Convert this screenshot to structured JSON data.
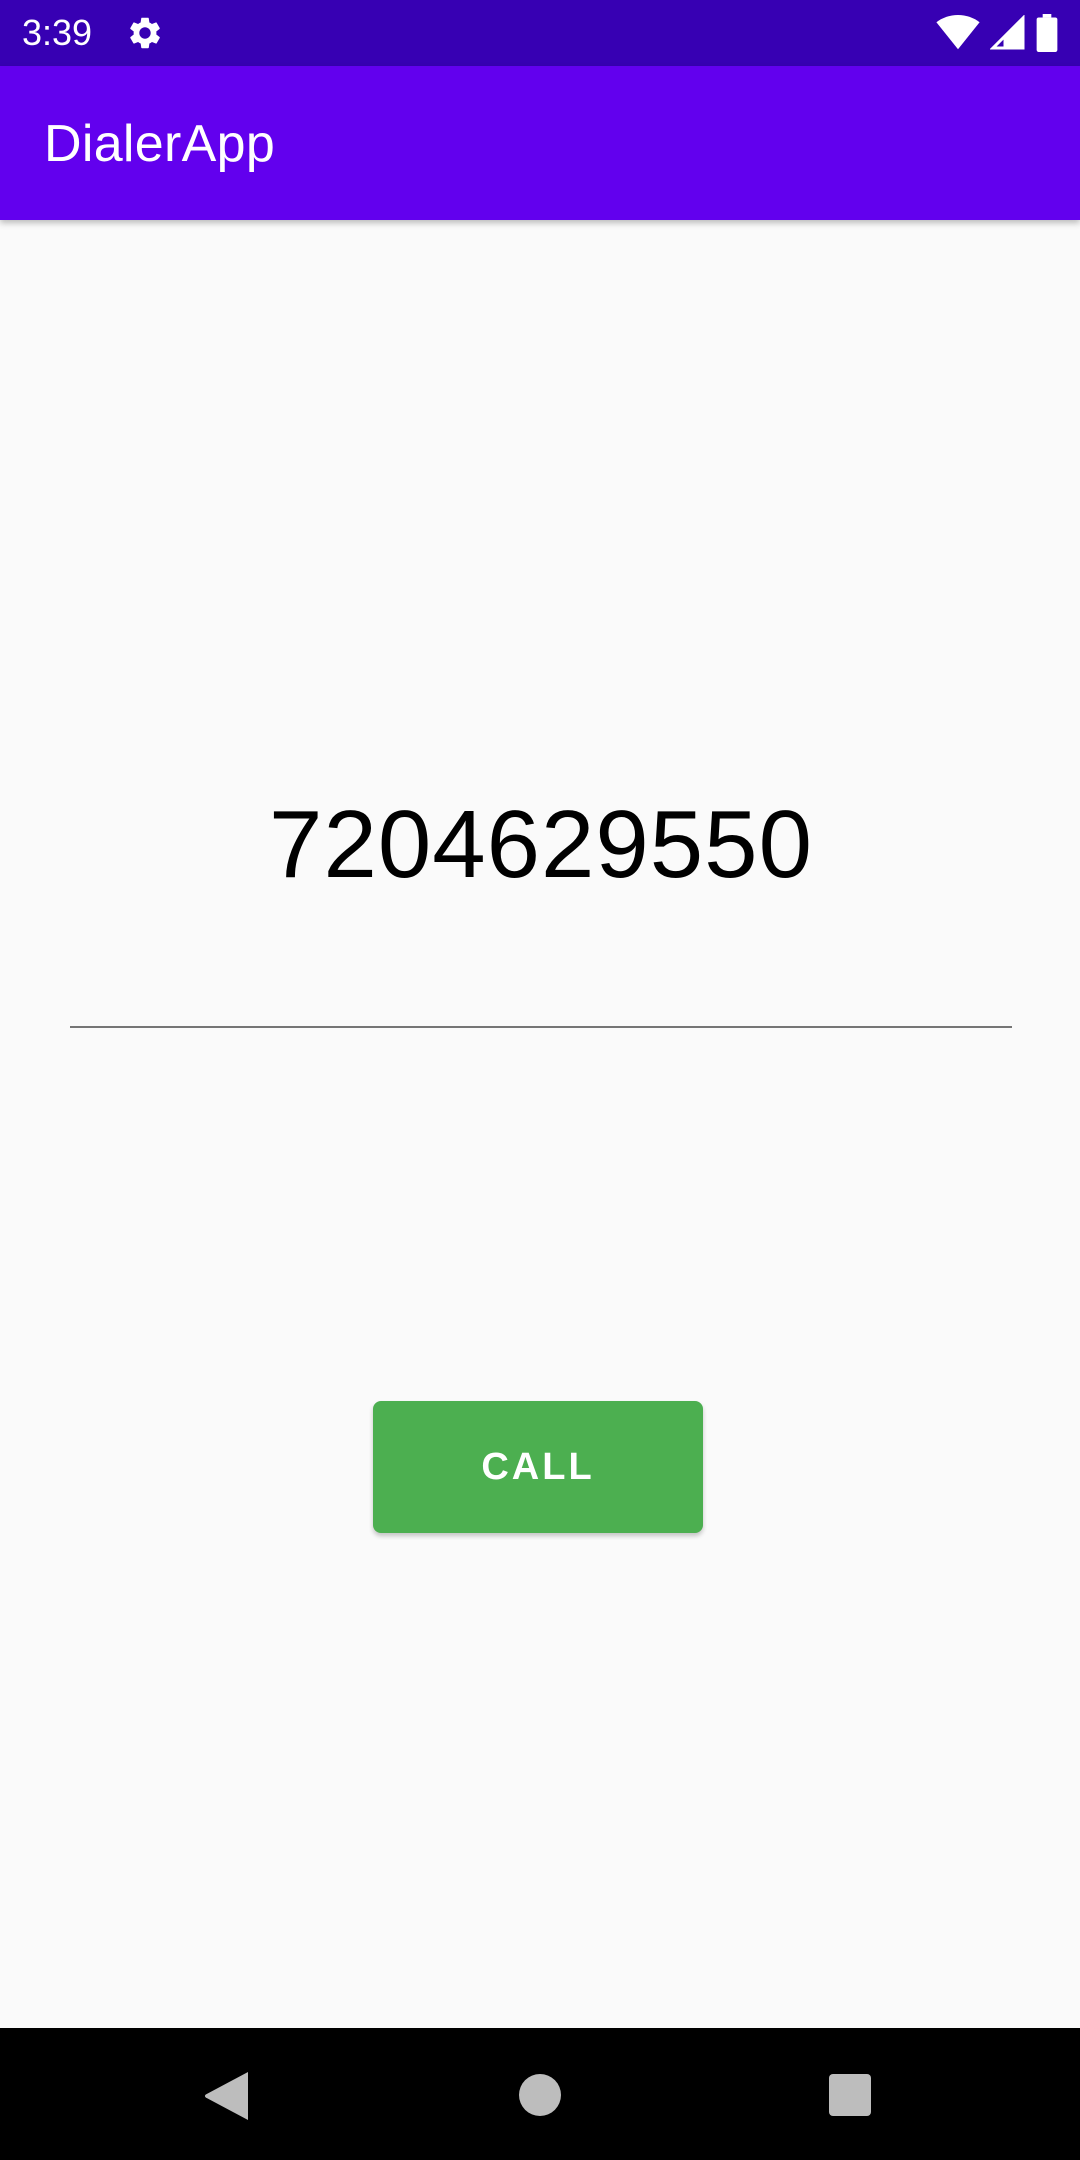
{
  "status_bar": {
    "time": "3:39",
    "icons": [
      "settings-icon",
      "wifi-icon",
      "cell-signal-icon",
      "battery-icon"
    ],
    "background_color": "#3700b3"
  },
  "app_bar": {
    "title": "DialerApp",
    "background_color": "#6200ee"
  },
  "dialer": {
    "phone_number": "7204629550",
    "call_button_label": "CALL",
    "call_button_color": "#4caf50"
  },
  "nav_bar": {
    "icons": [
      "back-icon",
      "home-icon",
      "recents-icon"
    ]
  }
}
